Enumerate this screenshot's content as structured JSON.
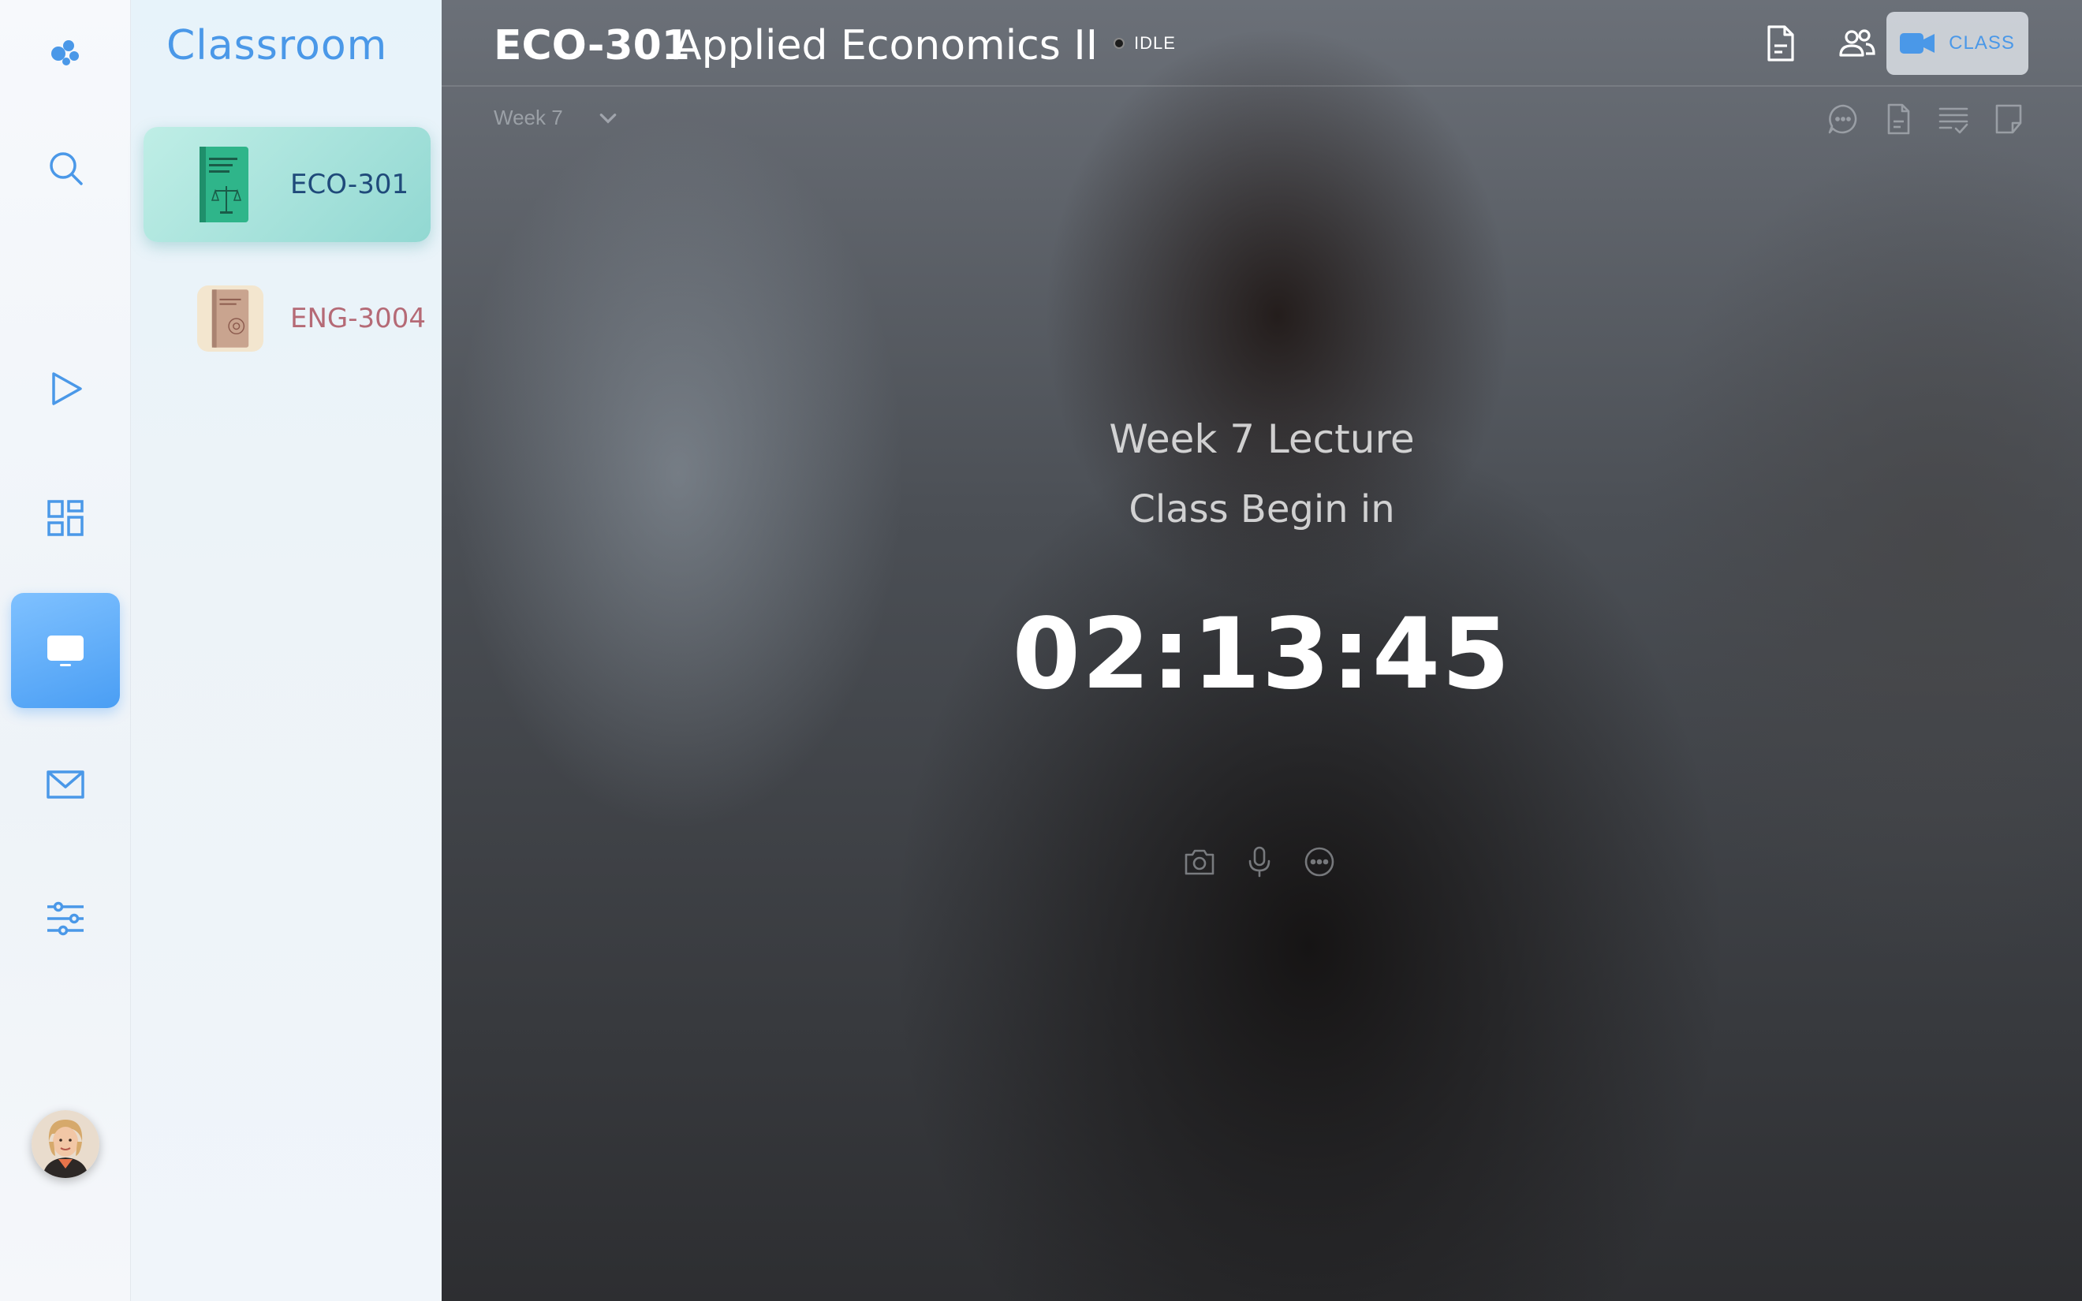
{
  "sidebar": {
    "items": [
      {
        "name": "logo-icon"
      },
      {
        "name": "search-icon"
      },
      {
        "name": "play-icon"
      },
      {
        "name": "dashboard-icon"
      },
      {
        "name": "classroom-icon",
        "active": true
      },
      {
        "name": "mail-icon"
      },
      {
        "name": "settings-sliders-icon"
      }
    ],
    "accent_color": "#4a98e8"
  },
  "panel": {
    "title": "Classroom",
    "courses": [
      {
        "code": "ECO-301",
        "active": true,
        "color": "#1f4a7a"
      },
      {
        "code": "ENG-3004",
        "active": false,
        "color": "#b56a76"
      }
    ]
  },
  "header": {
    "course_code": "ECO-301",
    "course_name": "Applied Economics II",
    "status": "IDLE",
    "class_button_label": "CLASS"
  },
  "toolbar": {
    "week_label": "Week 7"
  },
  "lecture": {
    "title": "Week 7 Lecture",
    "subtitle": "Class Begin in",
    "countdown": "02:13:45"
  }
}
